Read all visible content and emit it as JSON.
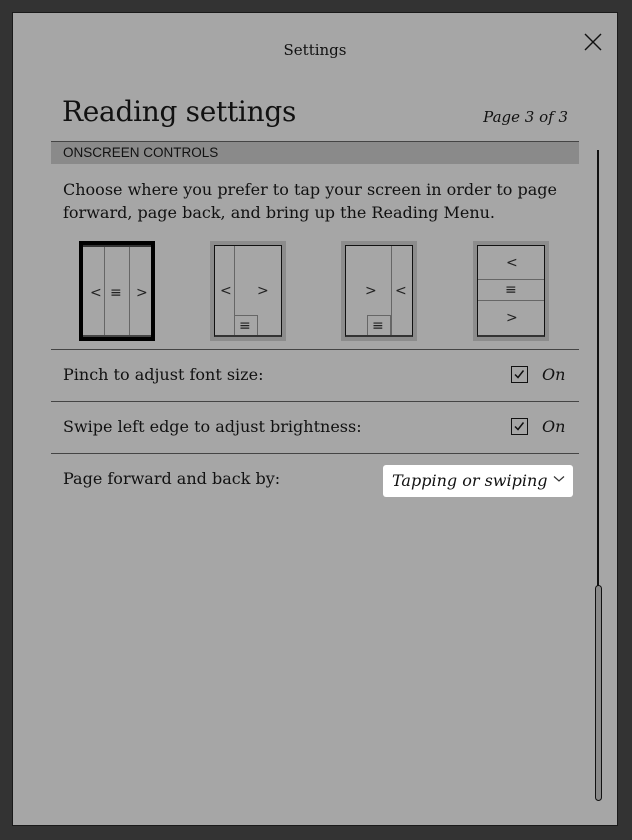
{
  "header": {
    "title": "Settings",
    "close_icon": "close-icon"
  },
  "page": {
    "title": "Reading settings",
    "page_indicator": "Page 3 of 3"
  },
  "section": {
    "title": "ONSCREEN CONTROLS",
    "description": "Choose where you prefer to tap your screen in order to page forward, page back, and bring up the Reading Menu."
  },
  "layouts": [
    {
      "name": "three-columns",
      "selected": true,
      "glyphs": [
        "<",
        "≡",
        ">"
      ]
    },
    {
      "name": "left-back-right-forward-bottom-menu",
      "selected": false,
      "glyphs": [
        "<",
        ">",
        "≡"
      ]
    },
    {
      "name": "left-forward-right-back-bottom-menu",
      "selected": false,
      "glyphs": [
        ">",
        "<",
        "≡"
      ]
    },
    {
      "name": "three-rows",
      "selected": false,
      "glyphs": [
        "<",
        "≡",
        ">"
      ]
    }
  ],
  "settings": [
    {
      "label": "Pinch to adjust font size:",
      "checked": true,
      "state": "On"
    },
    {
      "label": "Swipe left edge to adjust brightness:",
      "checked": true,
      "state": "On"
    },
    {
      "label": "Page forward and back by:",
      "value": "Tapping or swiping"
    }
  ],
  "scroll": {
    "position": "bottom"
  }
}
